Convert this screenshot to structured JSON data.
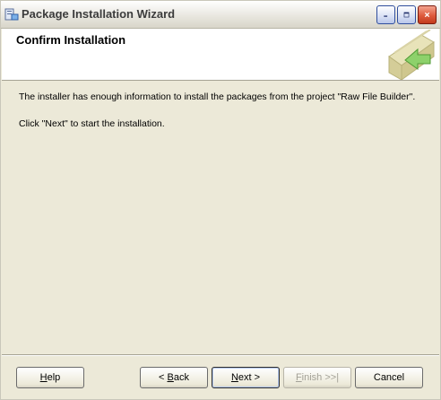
{
  "window": {
    "title": "Package Installation Wizard"
  },
  "header": {
    "title": "Confirm Installation"
  },
  "content": {
    "message_line": "The installer has enough information to install the packages from the project \"Raw File Builder\".",
    "instruction": "Click \"Next\" to start the installation."
  },
  "buttons": {
    "help": {
      "mnemonic": "H",
      "rest": "elp"
    },
    "back": {
      "prefix": "< ",
      "mnemonic": "B",
      "rest": "ack"
    },
    "next": {
      "mnemonic": "N",
      "rest": "ext >"
    },
    "finish": {
      "mnemonic": "F",
      "rest": "inish >>|"
    },
    "cancel": {
      "label": "Cancel"
    }
  },
  "colors": {
    "window_face": "#ECE9D8",
    "close_button": "#DE5B3C",
    "caption_button": "#D8E0F5"
  }
}
